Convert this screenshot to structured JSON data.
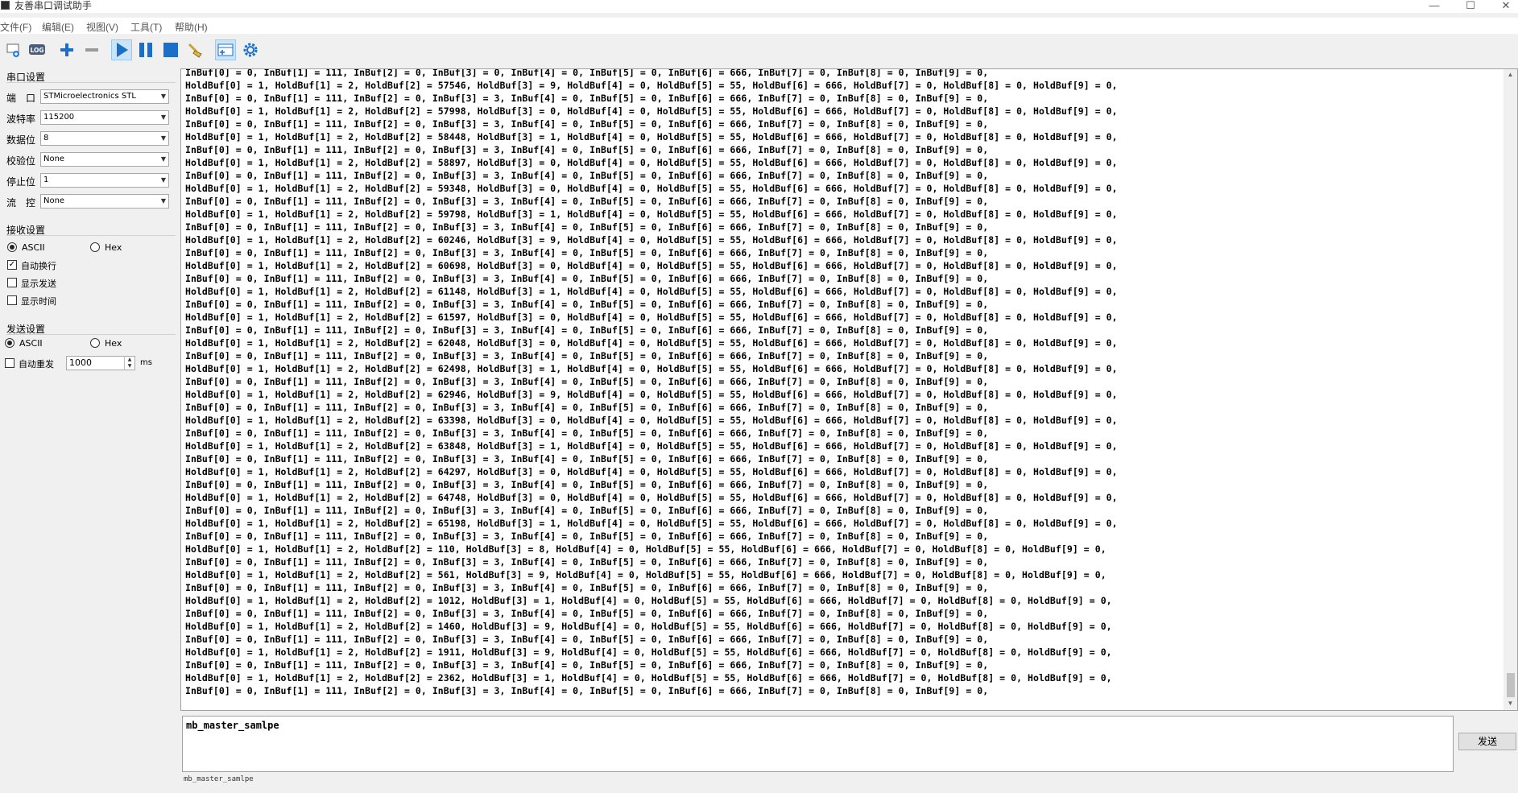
{
  "window": {
    "title": "友善串口调试助手",
    "minimize": "—",
    "maximize": "☐",
    "close": "✕"
  },
  "menu": [
    "文件(F)",
    "编辑(E)",
    "视图(V)",
    "工具(T)",
    "帮助(H)"
  ],
  "toolbar": {
    "log_label": "LOG"
  },
  "serial_settings": {
    "title": "串口设置",
    "port_label": "端　口",
    "port_value": "STMicroelectronics STL",
    "baud_label": "波特率",
    "baud_value": "115200",
    "databits_label": "数据位",
    "databits_value": "8",
    "parity_label": "校验位",
    "parity_value": "None",
    "stopbits_label": "停止位",
    "stopbits_value": "1",
    "flow_label": "流　控",
    "flow_value": "None"
  },
  "receive_settings": {
    "title": "接收设置",
    "ascii": "ASCII",
    "hex": "Hex",
    "auto_wrap": "自动换行",
    "show_send": "显示发送",
    "show_time": "显示时间"
  },
  "send_settings": {
    "title": "发送设置",
    "ascii": "ASCII",
    "hex": "Hex",
    "auto_resend": "自动重发",
    "interval": "1000",
    "unit": "ms"
  },
  "receive": {
    "partial_top": "InBuf[0] = 0, InBuf[1] = 111, InBuf[2] = 0, InBuf[3] = 0, InBuf[4] = 0, InBuf[5] = 0, InBuf[6] = 666, InBuf[7] = 0, InBuf[8] = 0, InBuf[9] = 0,",
    "lines": [
      "HoldBuf[0] = 1, HoldBuf[1] = 2, HoldBuf[2] = 57546, HoldBuf[3] = 9, HoldBuf[4] = 0, HoldBuf[5] = 55, HoldBuf[6] = 666, HoldBuf[7] = 0, HoldBuf[8] = 0, HoldBuf[9] = 0,",
      "InBuf[0] = 0, InBuf[1] = 111, InBuf[2] = 0, InBuf[3] = 3, InBuf[4] = 0, InBuf[5] = 0, InBuf[6] = 666, InBuf[7] = 0, InBuf[8] = 0, InBuf[9] = 0,",
      "HoldBuf[0] = 1, HoldBuf[1] = 2, HoldBuf[2] = 57998, HoldBuf[3] = 0, HoldBuf[4] = 0, HoldBuf[5] = 55, HoldBuf[6] = 666, HoldBuf[7] = 0, HoldBuf[8] = 0, HoldBuf[9] = 0,",
      "InBuf[0] = 0, InBuf[1] = 111, InBuf[2] = 0, InBuf[3] = 3, InBuf[4] = 0, InBuf[5] = 0, InBuf[6] = 666, InBuf[7] = 0, InBuf[8] = 0, InBuf[9] = 0,",
      "HoldBuf[0] = 1, HoldBuf[1] = 2, HoldBuf[2] = 58448, HoldBuf[3] = 1, HoldBuf[4] = 0, HoldBuf[5] = 55, HoldBuf[6] = 666, HoldBuf[7] = 0, HoldBuf[8] = 0, HoldBuf[9] = 0,",
      "InBuf[0] = 0, InBuf[1] = 111, InBuf[2] = 0, InBuf[3] = 3, InBuf[4] = 0, InBuf[5] = 0, InBuf[6] = 666, InBuf[7] = 0, InBuf[8] = 0, InBuf[9] = 0,",
      "HoldBuf[0] = 1, HoldBuf[1] = 2, HoldBuf[2] = 58897, HoldBuf[3] = 0, HoldBuf[4] = 0, HoldBuf[5] = 55, HoldBuf[6] = 666, HoldBuf[7] = 0, HoldBuf[8] = 0, HoldBuf[9] = 0,",
      "InBuf[0] = 0, InBuf[1] = 111, InBuf[2] = 0, InBuf[3] = 3, InBuf[4] = 0, InBuf[5] = 0, InBuf[6] = 666, InBuf[7] = 0, InBuf[8] = 0, InBuf[9] = 0,",
      "HoldBuf[0] = 1, HoldBuf[1] = 2, HoldBuf[2] = 59348, HoldBuf[3] = 0, HoldBuf[4] = 0, HoldBuf[5] = 55, HoldBuf[6] = 666, HoldBuf[7] = 0, HoldBuf[8] = 0, HoldBuf[9] = 0,",
      "InBuf[0] = 0, InBuf[1] = 111, InBuf[2] = 0, InBuf[3] = 3, InBuf[4] = 0, InBuf[5] = 0, InBuf[6] = 666, InBuf[7] = 0, InBuf[8] = 0, InBuf[9] = 0,",
      "HoldBuf[0] = 1, HoldBuf[1] = 2, HoldBuf[2] = 59798, HoldBuf[3] = 1, HoldBuf[4] = 0, HoldBuf[5] = 55, HoldBuf[6] = 666, HoldBuf[7] = 0, HoldBuf[8] = 0, HoldBuf[9] = 0,",
      "InBuf[0] = 0, InBuf[1] = 111, InBuf[2] = 0, InBuf[3] = 3, InBuf[4] = 0, InBuf[5] = 0, InBuf[6] = 666, InBuf[7] = 0, InBuf[8] = 0, InBuf[9] = 0,",
      "HoldBuf[0] = 1, HoldBuf[1] = 2, HoldBuf[2] = 60246, HoldBuf[3] = 9, HoldBuf[4] = 0, HoldBuf[5] = 55, HoldBuf[6] = 666, HoldBuf[7] = 0, HoldBuf[8] = 0, HoldBuf[9] = 0,",
      "InBuf[0] = 0, InBuf[1] = 111, InBuf[2] = 0, InBuf[3] = 3, InBuf[4] = 0, InBuf[5] = 0, InBuf[6] = 666, InBuf[7] = 0, InBuf[8] = 0, InBuf[9] = 0,",
      "HoldBuf[0] = 1, HoldBuf[1] = 2, HoldBuf[2] = 60698, HoldBuf[3] = 0, HoldBuf[4] = 0, HoldBuf[5] = 55, HoldBuf[6] = 666, HoldBuf[7] = 0, HoldBuf[8] = 0, HoldBuf[9] = 0,",
      "InBuf[0] = 0, InBuf[1] = 111, InBuf[2] = 0, InBuf[3] = 3, InBuf[4] = 0, InBuf[5] = 0, InBuf[6] = 666, InBuf[7] = 0, InBuf[8] = 0, InBuf[9] = 0,",
      "HoldBuf[0] = 1, HoldBuf[1] = 2, HoldBuf[2] = 61148, HoldBuf[3] = 1, HoldBuf[4] = 0, HoldBuf[5] = 55, HoldBuf[6] = 666, HoldBuf[7] = 0, HoldBuf[8] = 0, HoldBuf[9] = 0,",
      "InBuf[0] = 0, InBuf[1] = 111, InBuf[2] = 0, InBuf[3] = 3, InBuf[4] = 0, InBuf[5] = 0, InBuf[6] = 666, InBuf[7] = 0, InBuf[8] = 0, InBuf[9] = 0,",
      "HoldBuf[0] = 1, HoldBuf[1] = 2, HoldBuf[2] = 61597, HoldBuf[3] = 0, HoldBuf[4] = 0, HoldBuf[5] = 55, HoldBuf[6] = 666, HoldBuf[7] = 0, HoldBuf[8] = 0, HoldBuf[9] = 0,",
      "InBuf[0] = 0, InBuf[1] = 111, InBuf[2] = 0, InBuf[3] = 3, InBuf[4] = 0, InBuf[5] = 0, InBuf[6] = 666, InBuf[7] = 0, InBuf[8] = 0, InBuf[9] = 0,",
      "HoldBuf[0] = 1, HoldBuf[1] = 2, HoldBuf[2] = 62048, HoldBuf[3] = 0, HoldBuf[4] = 0, HoldBuf[5] = 55, HoldBuf[6] = 666, HoldBuf[7] = 0, HoldBuf[8] = 0, HoldBuf[9] = 0,",
      "InBuf[0] = 0, InBuf[1] = 111, InBuf[2] = 0, InBuf[3] = 3, InBuf[4] = 0, InBuf[5] = 0, InBuf[6] = 666, InBuf[7] = 0, InBuf[8] = 0, InBuf[9] = 0,",
      "HoldBuf[0] = 1, HoldBuf[1] = 2, HoldBuf[2] = 62498, HoldBuf[3] = 1, HoldBuf[4] = 0, HoldBuf[5] = 55, HoldBuf[6] = 666, HoldBuf[7] = 0, HoldBuf[8] = 0, HoldBuf[9] = 0,",
      "InBuf[0] = 0, InBuf[1] = 111, InBuf[2] = 0, InBuf[3] = 3, InBuf[4] = 0, InBuf[5] = 0, InBuf[6] = 666, InBuf[7] = 0, InBuf[8] = 0, InBuf[9] = 0,",
      "HoldBuf[0] = 1, HoldBuf[1] = 2, HoldBuf[2] = 62946, HoldBuf[3] = 9, HoldBuf[4] = 0, HoldBuf[5] = 55, HoldBuf[6] = 666, HoldBuf[7] = 0, HoldBuf[8] = 0, HoldBuf[9] = 0,",
      "InBuf[0] = 0, InBuf[1] = 111, InBuf[2] = 0, InBuf[3] = 3, InBuf[4] = 0, InBuf[5] = 0, InBuf[6] = 666, InBuf[7] = 0, InBuf[8] = 0, InBuf[9] = 0,",
      "HoldBuf[0] = 1, HoldBuf[1] = 2, HoldBuf[2] = 63398, HoldBuf[3] = 0, HoldBuf[4] = 0, HoldBuf[5] = 55, HoldBuf[6] = 666, HoldBuf[7] = 0, HoldBuf[8] = 0, HoldBuf[9] = 0,",
      "InBuf[0] = 0, InBuf[1] = 111, InBuf[2] = 0, InBuf[3] = 3, InBuf[4] = 0, InBuf[5] = 0, InBuf[6] = 666, InBuf[7] = 0, InBuf[8] = 0, InBuf[9] = 0,",
      "HoldBuf[0] = 1, HoldBuf[1] = 2, HoldBuf[2] = 63848, HoldBuf[3] = 1, HoldBuf[4] = 0, HoldBuf[5] = 55, HoldBuf[6] = 666, HoldBuf[7] = 0, HoldBuf[8] = 0, HoldBuf[9] = 0,",
      "InBuf[0] = 0, InBuf[1] = 111, InBuf[2] = 0, InBuf[3] = 3, InBuf[4] = 0, InBuf[5] = 0, InBuf[6] = 666, InBuf[7] = 0, InBuf[8] = 0, InBuf[9] = 0,",
      "HoldBuf[0] = 1, HoldBuf[1] = 2, HoldBuf[2] = 64297, HoldBuf[3] = 0, HoldBuf[4] = 0, HoldBuf[5] = 55, HoldBuf[6] = 666, HoldBuf[7] = 0, HoldBuf[8] = 0, HoldBuf[9] = 0,",
      "InBuf[0] = 0, InBuf[1] = 111, InBuf[2] = 0, InBuf[3] = 3, InBuf[4] = 0, InBuf[5] = 0, InBuf[6] = 666, InBuf[7] = 0, InBuf[8] = 0, InBuf[9] = 0,",
      "HoldBuf[0] = 1, HoldBuf[1] = 2, HoldBuf[2] = 64748, HoldBuf[3] = 0, HoldBuf[4] = 0, HoldBuf[5] = 55, HoldBuf[6] = 666, HoldBuf[7] = 0, HoldBuf[8] = 0, HoldBuf[9] = 0,",
      "InBuf[0] = 0, InBuf[1] = 111, InBuf[2] = 0, InBuf[3] = 3, InBuf[4] = 0, InBuf[5] = 0, InBuf[6] = 666, InBuf[7] = 0, InBuf[8] = 0, InBuf[9] = 0,",
      "HoldBuf[0] = 1, HoldBuf[1] = 2, HoldBuf[2] = 65198, HoldBuf[3] = 1, HoldBuf[4] = 0, HoldBuf[5] = 55, HoldBuf[6] = 666, HoldBuf[7] = 0, HoldBuf[8] = 0, HoldBuf[9] = 0,",
      "InBuf[0] = 0, InBuf[1] = 111, InBuf[2] = 0, InBuf[3] = 3, InBuf[4] = 0, InBuf[5] = 0, InBuf[6] = 666, InBuf[7] = 0, InBuf[8] = 0, InBuf[9] = 0,",
      "HoldBuf[0] = 1, HoldBuf[1] = 2, HoldBuf[2] = 110, HoldBuf[3] = 8, HoldBuf[4] = 0, HoldBuf[5] = 55, HoldBuf[6] = 666, HoldBuf[7] = 0, HoldBuf[8] = 0, HoldBuf[9] = 0,",
      "InBuf[0] = 0, InBuf[1] = 111, InBuf[2] = 0, InBuf[3] = 3, InBuf[4] = 0, InBuf[5] = 0, InBuf[6] = 666, InBuf[7] = 0, InBuf[8] = 0, InBuf[9] = 0,",
      "HoldBuf[0] = 1, HoldBuf[1] = 2, HoldBuf[2] = 561, HoldBuf[3] = 9, HoldBuf[4] = 0, HoldBuf[5] = 55, HoldBuf[6] = 666, HoldBuf[7] = 0, HoldBuf[8] = 0, HoldBuf[9] = 0,",
      "InBuf[0] = 0, InBuf[1] = 111, InBuf[2] = 0, InBuf[3] = 3, InBuf[4] = 0, InBuf[5] = 0, InBuf[6] = 666, InBuf[7] = 0, InBuf[8] = 0, InBuf[9] = 0,",
      "HoldBuf[0] = 1, HoldBuf[1] = 2, HoldBuf[2] = 1012, HoldBuf[3] = 1, HoldBuf[4] = 0, HoldBuf[5] = 55, HoldBuf[6] = 666, HoldBuf[7] = 0, HoldBuf[8] = 0, HoldBuf[9] = 0,",
      "InBuf[0] = 0, InBuf[1] = 111, InBuf[2] = 0, InBuf[3] = 3, InBuf[4] = 0, InBuf[5] = 0, InBuf[6] = 666, InBuf[7] = 0, InBuf[8] = 0, InBuf[9] = 0,",
      "HoldBuf[0] = 1, HoldBuf[1] = 2, HoldBuf[2] = 1460, HoldBuf[3] = 9, HoldBuf[4] = 0, HoldBuf[5] = 55, HoldBuf[6] = 666, HoldBuf[7] = 0, HoldBuf[8] = 0, HoldBuf[9] = 0,",
      "InBuf[0] = 0, InBuf[1] = 111, InBuf[2] = 0, InBuf[3] = 3, InBuf[4] = 0, InBuf[5] = 0, InBuf[6] = 666, InBuf[7] = 0, InBuf[8] = 0, InBuf[9] = 0,",
      "HoldBuf[0] = 1, HoldBuf[1] = 2, HoldBuf[2] = 1911, HoldBuf[3] = 9, HoldBuf[4] = 0, HoldBuf[5] = 55, HoldBuf[6] = 666, HoldBuf[7] = 0, HoldBuf[8] = 0, HoldBuf[9] = 0,",
      "InBuf[0] = 0, InBuf[1] = 111, InBuf[2] = 0, InBuf[3] = 3, InBuf[4] = 0, InBuf[5] = 0, InBuf[6] = 666, InBuf[7] = 0, InBuf[8] = 0, InBuf[9] = 0,",
      "HoldBuf[0] = 1, HoldBuf[1] = 2, HoldBuf[2] = 2362, HoldBuf[3] = 1, HoldBuf[4] = 0, HoldBuf[5] = 55, HoldBuf[6] = 666, HoldBuf[7] = 0, HoldBuf[8] = 0, HoldBuf[9] = 0,",
      "InBuf[0] = 0, InBuf[1] = 111, InBuf[2] = 0, InBuf[3] = 3, InBuf[4] = 0, InBuf[5] = 0, InBuf[6] = 666, InBuf[7] = 0, InBuf[8] = 0, InBuf[9] = 0,"
    ]
  },
  "send": {
    "text": "mb_master_samlpe",
    "button": "发送"
  },
  "status": {
    "text": "mb_master_samlpe"
  },
  "colors": {
    "accent": "#1c6fc9",
    "active_bg": "#cce4f7"
  }
}
